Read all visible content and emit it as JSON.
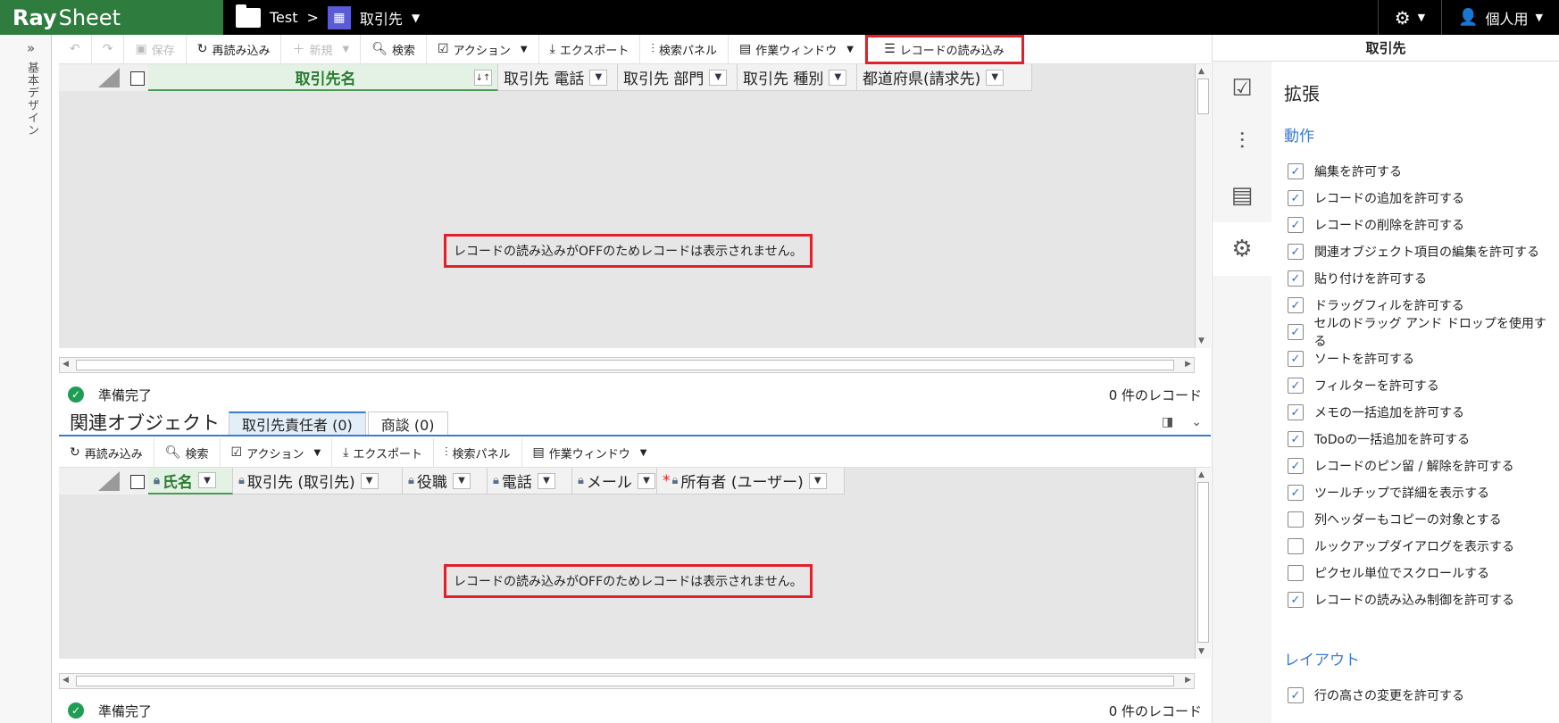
{
  "app": {
    "logo_bold": "Ray",
    "logo_rest": "Sheet"
  },
  "breadcrumb": {
    "folder": "Test",
    "sep": ">",
    "object": "取引先"
  },
  "topright": {
    "user": "個人用"
  },
  "leftrail": {
    "label": "基本デザイン"
  },
  "toolbar": {
    "undo": "↶",
    "redo": "↷",
    "save": "保存",
    "reload": "再読み込み",
    "new": "新規",
    "search": "検索",
    "action": "アクション",
    "export": "エクスポート",
    "search_panel": "検索パネル",
    "work_window": "作業ウィンドウ",
    "load_records": "レコードの読み込み"
  },
  "grid": {
    "columns": [
      {
        "label": "取引先名",
        "selected": true
      },
      {
        "label": "取引先 電話"
      },
      {
        "label": "取引先 部門"
      },
      {
        "label": "取引先 種別"
      },
      {
        "label": "都道府県(請求先)"
      }
    ],
    "message": "レコードの読み込みがOFFのためレコードは表示されません。"
  },
  "status": {
    "ready": "準備完了",
    "count": "0 件のレコード"
  },
  "related": {
    "title": "関連オブジェクト",
    "tabs": [
      {
        "label": "取引先責任者 (0)",
        "active": true
      },
      {
        "label": "商談 (0)"
      }
    ],
    "toolbar": {
      "reload": "再読み込み",
      "search": "検索",
      "action": "アクション",
      "export": "エクスポート",
      "search_panel": "検索パネル",
      "work_window": "作業ウィンドウ"
    },
    "columns": [
      {
        "label": "氏名",
        "lock": true,
        "selected": true
      },
      {
        "label": "取引先 (取引先)",
        "lock": true
      },
      {
        "label": "役職",
        "lock": true
      },
      {
        "label": "電話",
        "lock": true
      },
      {
        "label": "メール",
        "lock": true
      },
      {
        "label": "所有者 (ユーザー)",
        "lock": true,
        "required": true
      }
    ],
    "message": "レコードの読み込みがOFFのためレコードは表示されません。",
    "status": {
      "ready": "準備完了",
      "count": "0 件のレコード"
    }
  },
  "rightpanel": {
    "title": "取引先",
    "section": "拡張",
    "group_behavior": "動作",
    "options": [
      {
        "label": "編集を許可する",
        "checked": true
      },
      {
        "label": "レコードの追加を許可する",
        "checked": true
      },
      {
        "label": "レコードの削除を許可する",
        "checked": true
      },
      {
        "label": "関連オブジェクト項目の編集を許可する",
        "checked": true
      },
      {
        "label": "貼り付けを許可する",
        "checked": true
      },
      {
        "label": "ドラッグフィルを許可する",
        "checked": true
      },
      {
        "label": "セルのドラッグ アンド ドロップを使用する",
        "checked": true
      },
      {
        "label": "ソートを許可する",
        "checked": true
      },
      {
        "label": "フィルターを許可する",
        "checked": true
      },
      {
        "label": "メモの一括追加を許可する",
        "checked": true
      },
      {
        "label": "ToDoの一括追加を許可する",
        "checked": true
      },
      {
        "label": "レコードのピン留 / 解除を許可する",
        "checked": true
      },
      {
        "label": "ツールチップで詳細を表示する",
        "checked": true
      },
      {
        "label": "列ヘッダーもコピーの対象とする",
        "checked": false
      },
      {
        "label": "ルックアップダイアログを表示する",
        "checked": false
      },
      {
        "label": "ピクセル単位でスクロールする",
        "checked": false
      },
      {
        "label": "レコードの読み込み制御を許可する",
        "checked": true
      }
    ],
    "group_layout": "レイアウト",
    "layout_options": [
      {
        "label": "行の高さの変更を許可する",
        "checked": true
      }
    ]
  },
  "colors": {
    "logo_bg": "#2f7d3e",
    "highlight": "#e0202a",
    "accent": "#3a7bd5"
  }
}
